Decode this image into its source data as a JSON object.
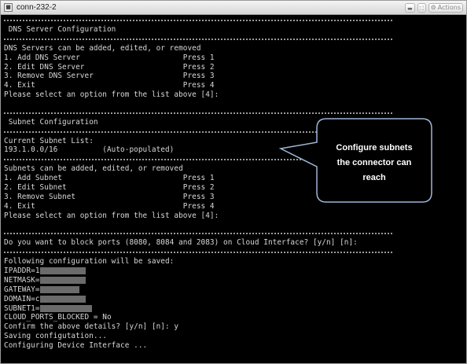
{
  "window": {
    "title": "conn-232-2",
    "icon": "terminal-window-icon",
    "actions_label": "Actions"
  },
  "terminal": {
    "lines": [
      {
        "kind": "sep"
      },
      {
        "kind": "text",
        "text": " DNS Server Configuration"
      },
      {
        "kind": "sep"
      },
      {
        "kind": "text",
        "text": "DNS Servers can be added, edited, or removed"
      },
      {
        "kind": "text",
        "text": "1. Add DNS Server                       Press 1"
      },
      {
        "kind": "text",
        "text": "2. Edit DNS Server                      Press 2"
      },
      {
        "kind": "text",
        "text": "3. Remove DNS Server                    Press 3"
      },
      {
        "kind": "text",
        "text": "4. Exit                                 Press 4"
      },
      {
        "kind": "text",
        "text": "Please select an option from the list above [4]:"
      },
      {
        "kind": "blank"
      },
      {
        "kind": "sep"
      },
      {
        "kind": "text",
        "text": " Subnet Configuration"
      },
      {
        "kind": "sep"
      },
      {
        "kind": "text",
        "text": "Current Subnet List:"
      },
      {
        "kind": "text",
        "text": "193.1.0.0/16          (Auto-populated)"
      },
      {
        "kind": "sep"
      },
      {
        "kind": "text",
        "text": "Subnets can be added, edited, or removed"
      },
      {
        "kind": "text",
        "text": "1. Add Subnet                           Press 1"
      },
      {
        "kind": "text",
        "text": "2. Edit Subnet                          Press 2"
      },
      {
        "kind": "text",
        "text": "3. Remove Subnet                        Press 3"
      },
      {
        "kind": "text",
        "text": "4. Exit                                 Press 4"
      },
      {
        "kind": "text",
        "text": "Please select an option from the list above [4]:"
      },
      {
        "kind": "blank"
      },
      {
        "kind": "sep"
      },
      {
        "kind": "text",
        "text": "Do you want to block ports (8080, 8084 and 2083) on Cloud Interface? [y/n] [n]:"
      },
      {
        "kind": "sep"
      },
      {
        "kind": "text",
        "text": "Following configuration will be saved:"
      },
      {
        "kind": "redacted",
        "text": "IPADDR=1",
        "redact_width": 58
      },
      {
        "kind": "redacted",
        "text": "NETMASK=",
        "redact_width": 58
      },
      {
        "kind": "redacted",
        "text": "GATEWAY=",
        "redact_width": 50
      },
      {
        "kind": "redacted",
        "text": "DOMAIN=c",
        "redact_width": 58
      },
      {
        "kind": "redacted",
        "text": "SUBNET1=",
        "redact_width": 66
      },
      {
        "kind": "text",
        "text": "CLOUD_PORTS_BLOCKED = No"
      },
      {
        "kind": "text",
        "text": "Confirm the above details? [y/n] [n]: y"
      },
      {
        "kind": "text",
        "text": "Saving configutation..."
      },
      {
        "kind": "text",
        "text": "Configuring Device Interface ..."
      }
    ]
  },
  "callout": {
    "text": "Configure subnets\nthe connector can\nreach",
    "fill": "#000000",
    "stroke": "#9fb6d6"
  }
}
